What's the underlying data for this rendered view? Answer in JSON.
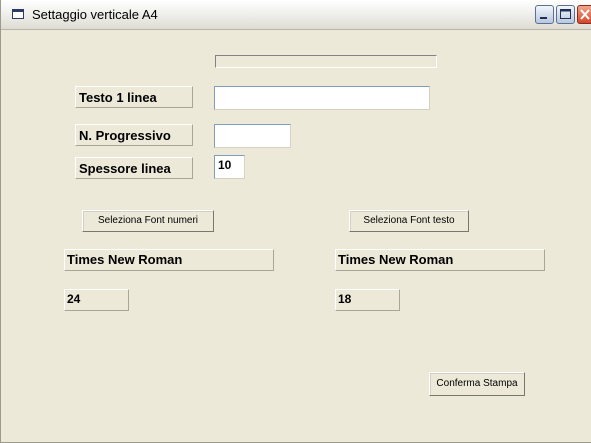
{
  "window": {
    "title": "Settaggio verticale A4"
  },
  "form": {
    "progress_fraction": 0,
    "label_testo": "Testo 1 linea",
    "input_testo_value": "",
    "label_progressivo": "N. Progressivo",
    "input_progressivo_value": "",
    "label_spessore": "Spessore linea",
    "input_spessore_value": "10",
    "btn_font_numeri": "Seleziona Font numeri",
    "btn_font_testo": "Seleziona Font testo",
    "font_numeri_name": "Times New Roman",
    "font_testo_name": "Times New Roman",
    "font_numeri_size": "24",
    "font_testo_size": "18",
    "btn_conferma": "Conferma Stampa"
  }
}
